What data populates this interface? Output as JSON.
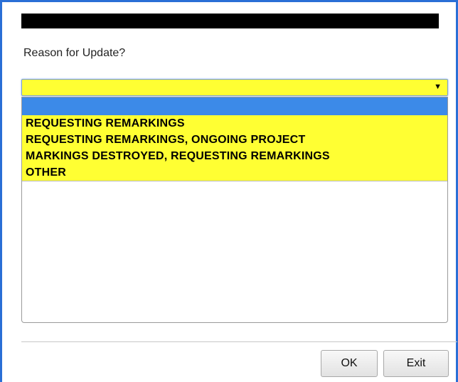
{
  "dialog": {
    "prompt": "Reason for Update?",
    "select": {
      "value": "",
      "arrow": "▼"
    },
    "options": [
      "",
      "REQUESTING REMARKINGS",
      "REQUESTING REMARKINGS, ONGOING PROJECT",
      "MARKINGS DESTROYED, REQUESTING REMARKINGS",
      "OTHER"
    ],
    "highlighted_index": 0,
    "buttons": {
      "ok": "OK",
      "exit": "Exit"
    }
  },
  "colors": {
    "select_bg": "#ffff33",
    "highlight": "#3c8ae8",
    "frame": "#2a6fd6"
  }
}
